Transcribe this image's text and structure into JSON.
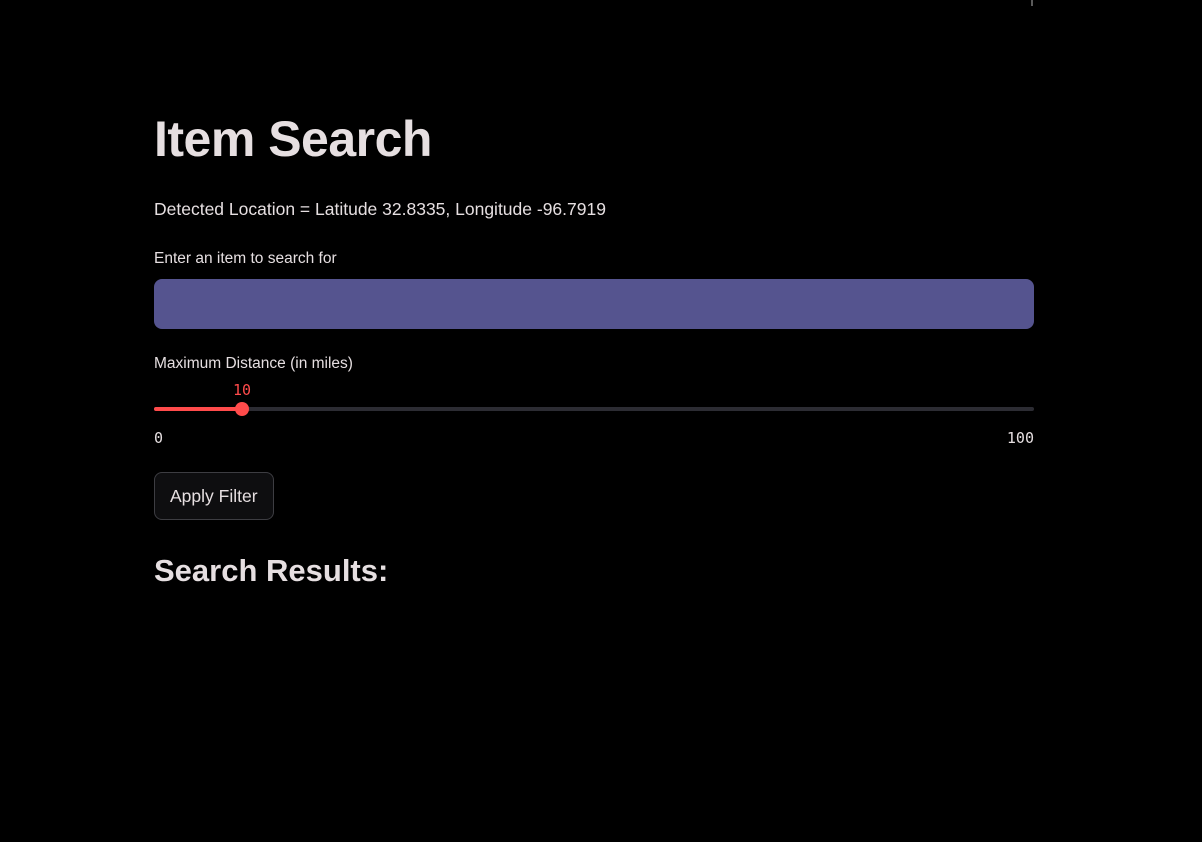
{
  "page": {
    "title": "Item Search",
    "location_text": "Detected Location = Latitude 32.8335, Longitude -96.7919"
  },
  "search": {
    "label": "Enter an item to search for",
    "value": "",
    "placeholder": ""
  },
  "distance": {
    "label": "Maximum Distance (in miles)",
    "value": 10,
    "value_label": "10",
    "min": 0,
    "max": 100,
    "min_label": "0",
    "max_label": "100"
  },
  "filter": {
    "button_label": "Apply Filter"
  },
  "results": {
    "heading": "Search Results:"
  },
  "colors": {
    "background": "#000000",
    "text": "#e6dfe1",
    "accent": "#ff4b4b",
    "input_background": "#55548f",
    "slider_track": "#2c2c33"
  }
}
